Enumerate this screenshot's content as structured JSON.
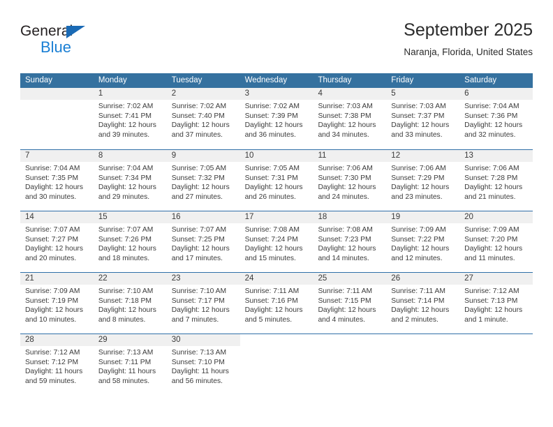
{
  "logo": {
    "word_top": "General",
    "word_bottom": "Blue"
  },
  "header": {
    "title": "September 2025",
    "subtitle": "Naranja, Florida, United States"
  },
  "colors": {
    "header_blue": "#35719f",
    "rule_blue": "#2f6fa8",
    "daynum_band": "#f0f0f0",
    "logo_blue": "#1a7fd4",
    "text": "#3b3b3b"
  },
  "weekdays": [
    "Sunday",
    "Monday",
    "Tuesday",
    "Wednesday",
    "Thursday",
    "Friday",
    "Saturday"
  ],
  "weeks": [
    {
      "filled_columns": 7,
      "days": [
        {
          "num": "",
          "lines": []
        },
        {
          "num": "1",
          "lines": [
            "Sunrise: 7:02 AM",
            "Sunset: 7:41 PM",
            "Daylight: 12 hours",
            "and 39 minutes."
          ]
        },
        {
          "num": "2",
          "lines": [
            "Sunrise: 7:02 AM",
            "Sunset: 7:40 PM",
            "Daylight: 12 hours",
            "and 37 minutes."
          ]
        },
        {
          "num": "3",
          "lines": [
            "Sunrise: 7:02 AM",
            "Sunset: 7:39 PM",
            "Daylight: 12 hours",
            "and 36 minutes."
          ]
        },
        {
          "num": "4",
          "lines": [
            "Sunrise: 7:03 AM",
            "Sunset: 7:38 PM",
            "Daylight: 12 hours",
            "and 34 minutes."
          ]
        },
        {
          "num": "5",
          "lines": [
            "Sunrise: 7:03 AM",
            "Sunset: 7:37 PM",
            "Daylight: 12 hours",
            "and 33 minutes."
          ]
        },
        {
          "num": "6",
          "lines": [
            "Sunrise: 7:04 AM",
            "Sunset: 7:36 PM",
            "Daylight: 12 hours",
            "and 32 minutes."
          ]
        }
      ]
    },
    {
      "filled_columns": 7,
      "days": [
        {
          "num": "7",
          "lines": [
            "Sunrise: 7:04 AM",
            "Sunset: 7:35 PM",
            "Daylight: 12 hours",
            "and 30 minutes."
          ]
        },
        {
          "num": "8",
          "lines": [
            "Sunrise: 7:04 AM",
            "Sunset: 7:34 PM",
            "Daylight: 12 hours",
            "and 29 minutes."
          ]
        },
        {
          "num": "9",
          "lines": [
            "Sunrise: 7:05 AM",
            "Sunset: 7:32 PM",
            "Daylight: 12 hours",
            "and 27 minutes."
          ]
        },
        {
          "num": "10",
          "lines": [
            "Sunrise: 7:05 AM",
            "Sunset: 7:31 PM",
            "Daylight: 12 hours",
            "and 26 minutes."
          ]
        },
        {
          "num": "11",
          "lines": [
            "Sunrise: 7:06 AM",
            "Sunset: 7:30 PM",
            "Daylight: 12 hours",
            "and 24 minutes."
          ]
        },
        {
          "num": "12",
          "lines": [
            "Sunrise: 7:06 AM",
            "Sunset: 7:29 PM",
            "Daylight: 12 hours",
            "and 23 minutes."
          ]
        },
        {
          "num": "13",
          "lines": [
            "Sunrise: 7:06 AM",
            "Sunset: 7:28 PM",
            "Daylight: 12 hours",
            "and 21 minutes."
          ]
        }
      ]
    },
    {
      "filled_columns": 7,
      "days": [
        {
          "num": "14",
          "lines": [
            "Sunrise: 7:07 AM",
            "Sunset: 7:27 PM",
            "Daylight: 12 hours",
            "and 20 minutes."
          ]
        },
        {
          "num": "15",
          "lines": [
            "Sunrise: 7:07 AM",
            "Sunset: 7:26 PM",
            "Daylight: 12 hours",
            "and 18 minutes."
          ]
        },
        {
          "num": "16",
          "lines": [
            "Sunrise: 7:07 AM",
            "Sunset: 7:25 PM",
            "Daylight: 12 hours",
            "and 17 minutes."
          ]
        },
        {
          "num": "17",
          "lines": [
            "Sunrise: 7:08 AM",
            "Sunset: 7:24 PM",
            "Daylight: 12 hours",
            "and 15 minutes."
          ]
        },
        {
          "num": "18",
          "lines": [
            "Sunrise: 7:08 AM",
            "Sunset: 7:23 PM",
            "Daylight: 12 hours",
            "and 14 minutes."
          ]
        },
        {
          "num": "19",
          "lines": [
            "Sunrise: 7:09 AM",
            "Sunset: 7:22 PM",
            "Daylight: 12 hours",
            "and 12 minutes."
          ]
        },
        {
          "num": "20",
          "lines": [
            "Sunrise: 7:09 AM",
            "Sunset: 7:20 PM",
            "Daylight: 12 hours",
            "and 11 minutes."
          ]
        }
      ]
    },
    {
      "filled_columns": 7,
      "days": [
        {
          "num": "21",
          "lines": [
            "Sunrise: 7:09 AM",
            "Sunset: 7:19 PM",
            "Daylight: 12 hours",
            "and 10 minutes."
          ]
        },
        {
          "num": "22",
          "lines": [
            "Sunrise: 7:10 AM",
            "Sunset: 7:18 PM",
            "Daylight: 12 hours",
            "and 8 minutes."
          ]
        },
        {
          "num": "23",
          "lines": [
            "Sunrise: 7:10 AM",
            "Sunset: 7:17 PM",
            "Daylight: 12 hours",
            "and 7 minutes."
          ]
        },
        {
          "num": "24",
          "lines": [
            "Sunrise: 7:11 AM",
            "Sunset: 7:16 PM",
            "Daylight: 12 hours",
            "and 5 minutes."
          ]
        },
        {
          "num": "25",
          "lines": [
            "Sunrise: 7:11 AM",
            "Sunset: 7:15 PM",
            "Daylight: 12 hours",
            "and 4 minutes."
          ]
        },
        {
          "num": "26",
          "lines": [
            "Sunrise: 7:11 AM",
            "Sunset: 7:14 PM",
            "Daylight: 12 hours",
            "and 2 minutes."
          ]
        },
        {
          "num": "27",
          "lines": [
            "Sunrise: 7:12 AM",
            "Sunset: 7:13 PM",
            "Daylight: 12 hours",
            "and 1 minute."
          ]
        }
      ]
    },
    {
      "filled_columns": 3,
      "days": [
        {
          "num": "28",
          "lines": [
            "Sunrise: 7:12 AM",
            "Sunset: 7:12 PM",
            "Daylight: 11 hours",
            "and 59 minutes."
          ]
        },
        {
          "num": "29",
          "lines": [
            "Sunrise: 7:13 AM",
            "Sunset: 7:11 PM",
            "Daylight: 11 hours",
            "and 58 minutes."
          ]
        },
        {
          "num": "30",
          "lines": [
            "Sunrise: 7:13 AM",
            "Sunset: 7:10 PM",
            "Daylight: 11 hours",
            "and 56 minutes."
          ]
        },
        {
          "num": "",
          "lines": []
        },
        {
          "num": "",
          "lines": []
        },
        {
          "num": "",
          "lines": []
        },
        {
          "num": "",
          "lines": []
        }
      ]
    }
  ]
}
